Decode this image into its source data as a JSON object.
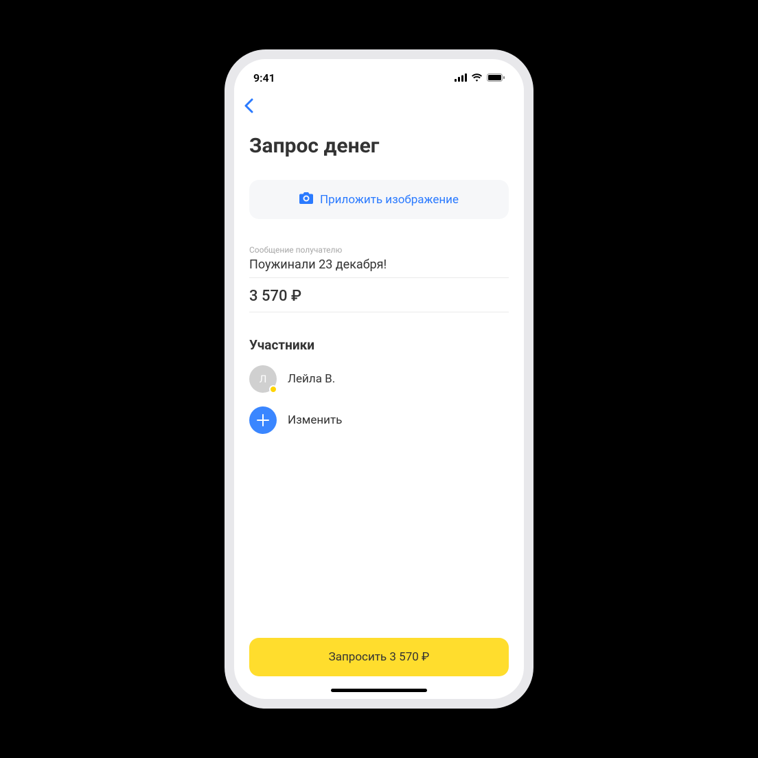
{
  "status": {
    "time": "9:41"
  },
  "page": {
    "title": "Запрос денег"
  },
  "attach": {
    "label": "Приложить изображение"
  },
  "message": {
    "label": "Сообщение получателю",
    "value": "Поужинали 23 декабря!"
  },
  "amount": {
    "display": "3 570 ₽"
  },
  "participants": {
    "title": "Участники",
    "items": [
      {
        "initial": "Л",
        "name": "Лейла В."
      }
    ],
    "change_label": "Изменить"
  },
  "footer": {
    "button_label": "Запросить 3 570 ₽"
  },
  "colors": {
    "accent_blue": "#2a7aff",
    "accent_yellow": "#ffdd2d"
  }
}
